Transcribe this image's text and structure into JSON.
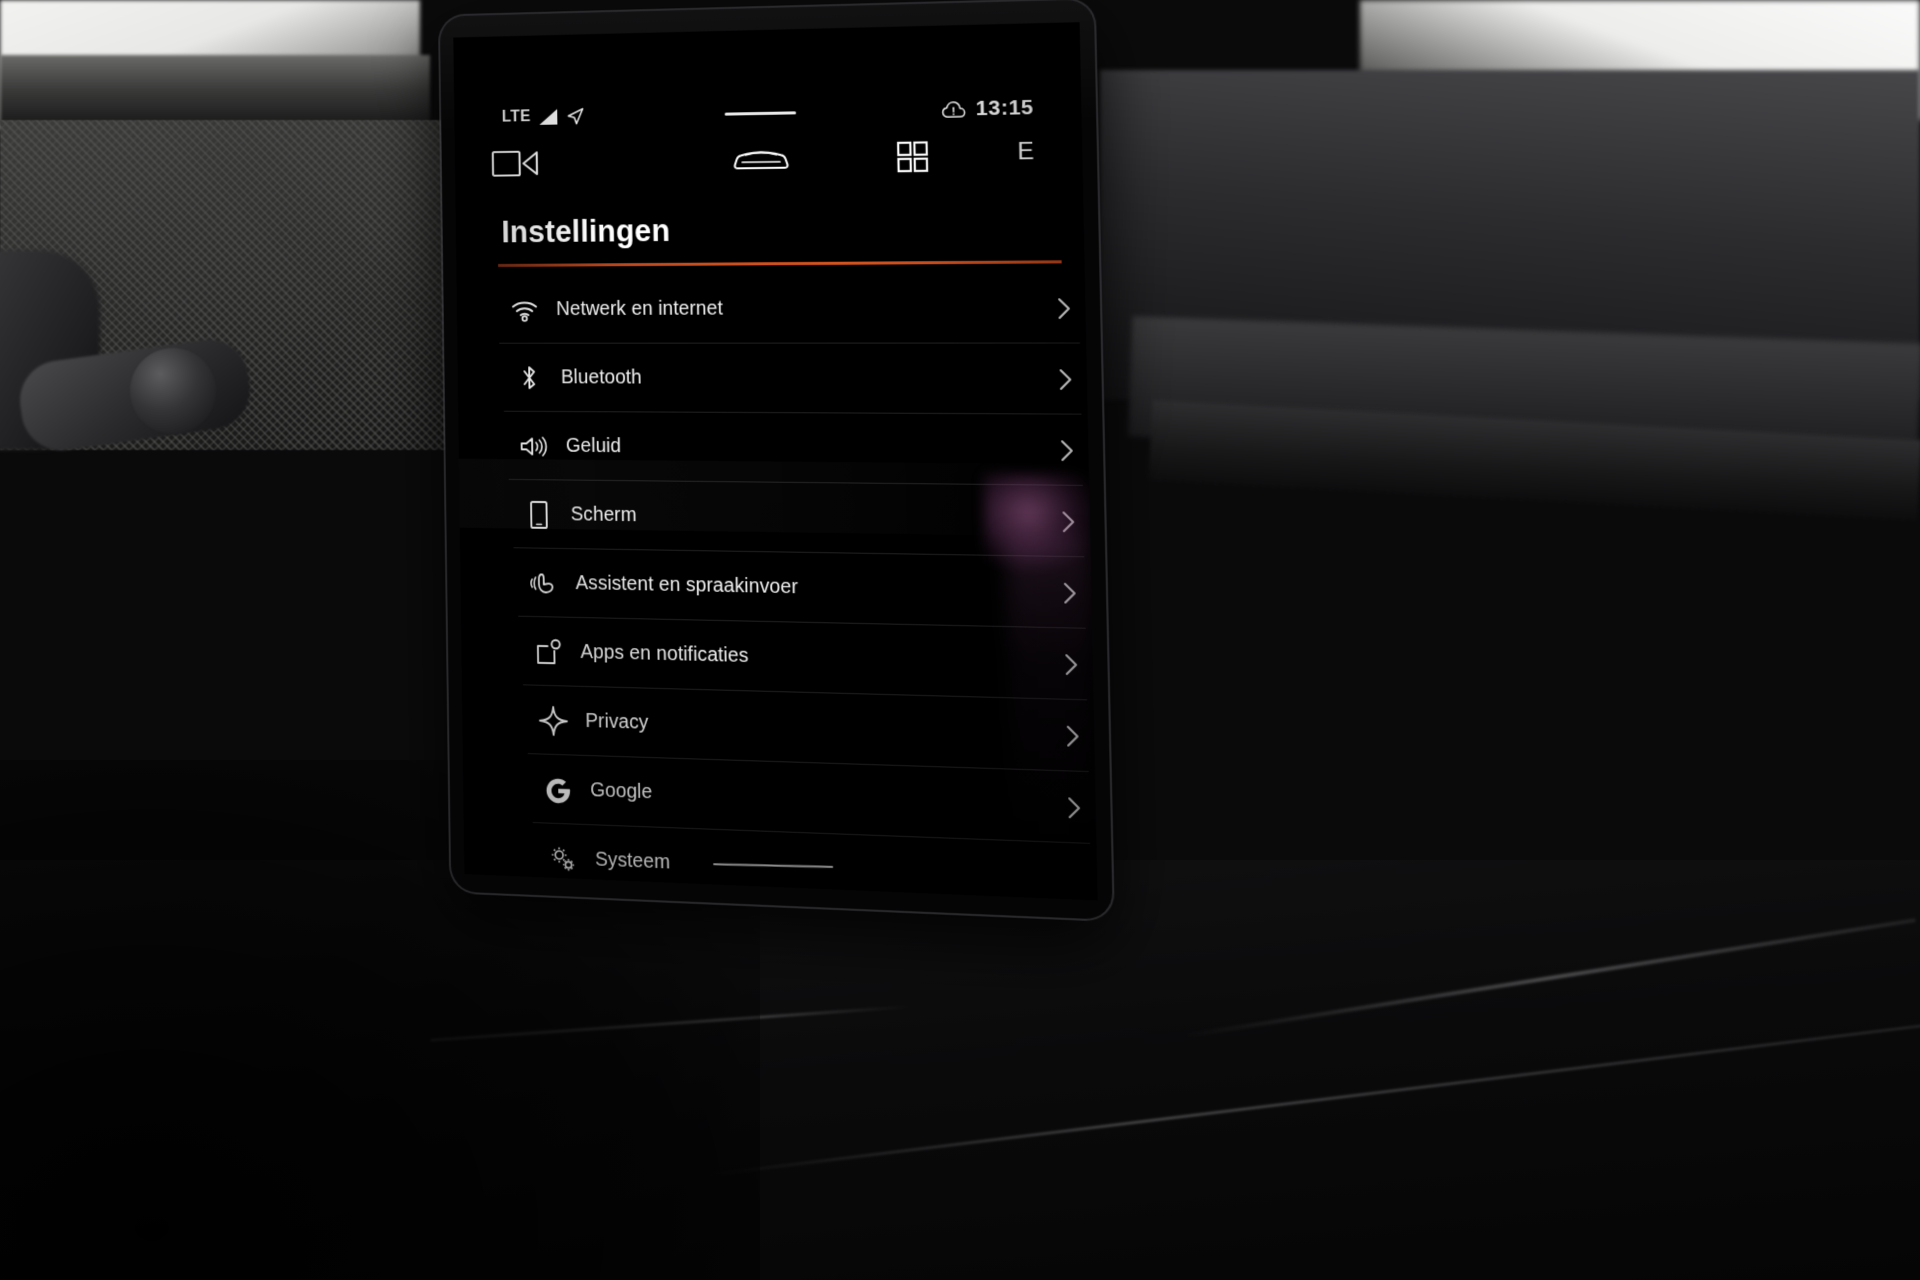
{
  "status_bar": {
    "network_label": "LTE",
    "signal_icon": "signal-bars-icon",
    "location_icon": "navigation-arrow-icon",
    "notification_pill": "notification-handle",
    "warning_icon": "cloud-warning-icon",
    "time": "13:15"
  },
  "nav_row": {
    "media_icon": "media-camera-icon",
    "car_icon": "car-icon",
    "apps_icon": "apps-grid-icon",
    "energy_label": "E"
  },
  "page": {
    "title": "Instellingen",
    "accent_color": "#d4541f",
    "background_color": "#000000",
    "text_color": "#f2f2f2"
  },
  "settings": {
    "items": [
      {
        "label": "Netwerk en internet",
        "icon": "wifi-icon"
      },
      {
        "label": "Bluetooth",
        "icon": "bluetooth-icon"
      },
      {
        "label": "Geluid",
        "icon": "volume-icon"
      },
      {
        "label": "Scherm",
        "icon": "display-icon"
      },
      {
        "label": "Assistent en spraakinvoer",
        "icon": "voice-assistant-icon"
      },
      {
        "label": "Apps en notificaties",
        "icon": "apps-notifications-icon"
      },
      {
        "label": "Privacy",
        "icon": "privacy-cross-icon"
      },
      {
        "label": "Google",
        "icon": "google-g-icon"
      },
      {
        "label": "Systeem",
        "icon": "system-gears-icon"
      }
    ]
  }
}
